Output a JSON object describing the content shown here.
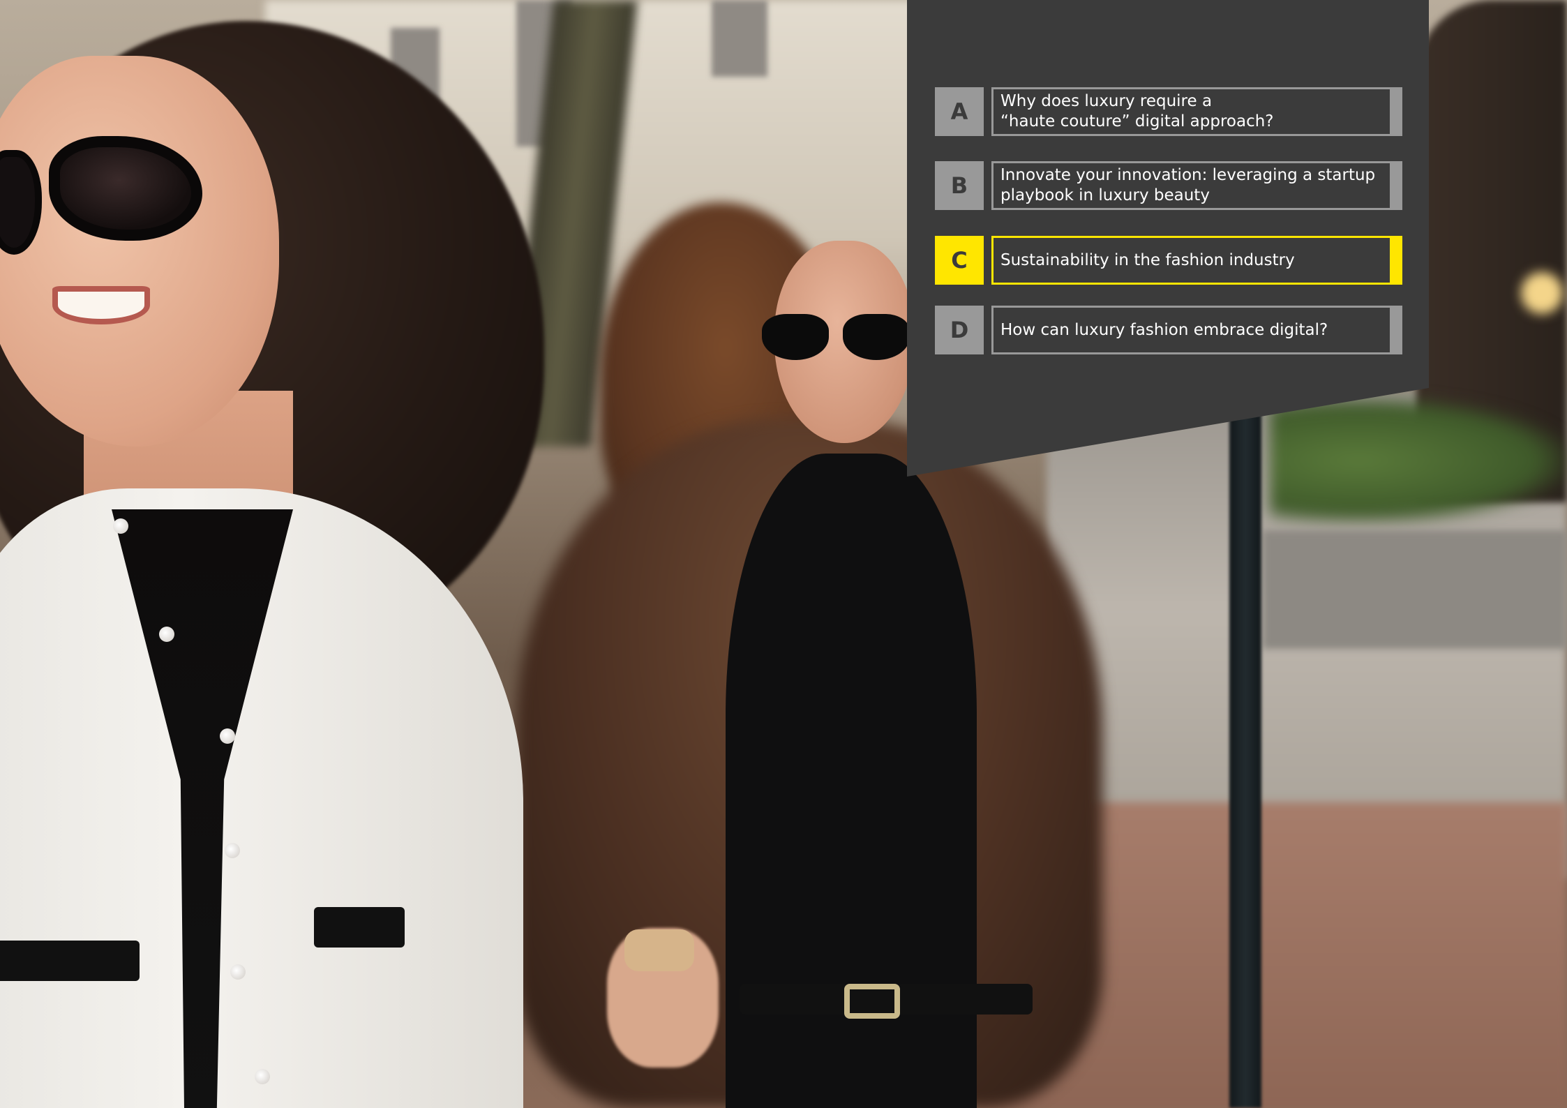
{
  "colors": {
    "panel_bg": "#3b3b3b",
    "neutral_grey": "#999999",
    "accent_yellow": "#ffe600",
    "text": "#ffffff"
  },
  "menu": {
    "selected": "C",
    "options": [
      {
        "letter": "A",
        "text": "Why does luxury require a\n“haute couture” digital approach?"
      },
      {
        "letter": "B",
        "text": "Innovate your innovation: leveraging a startup\nplaybook in luxury beauty"
      },
      {
        "letter": "C",
        "text": "Sustainability in the fashion industry"
      },
      {
        "letter": "D",
        "text": "How can luxury fashion embrace digital?"
      }
    ]
  }
}
